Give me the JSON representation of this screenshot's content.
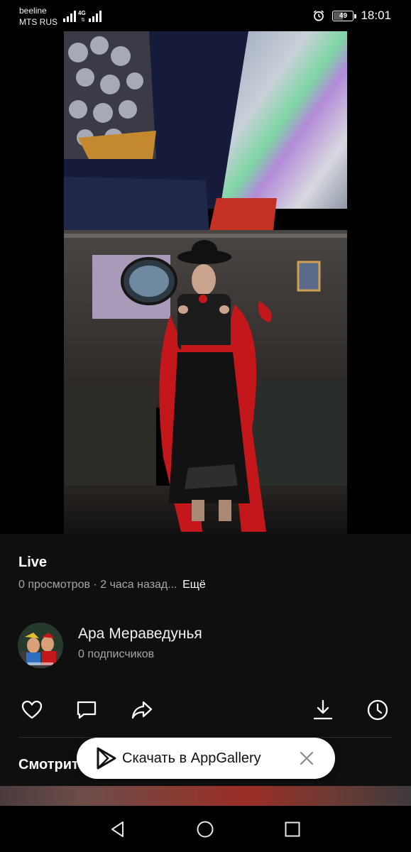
{
  "status_bar": {
    "carrier_1": "beeline",
    "carrier_2": "MTS RUS",
    "network": "4G",
    "battery": "49",
    "time": "18:01"
  },
  "video": {
    "title": "Live",
    "views": "0 просмотров",
    "separator": "·",
    "age": "2 часа назад...",
    "more_label": "Ещё"
  },
  "channel": {
    "name": "Ара Мераведунья",
    "subscribers": "0 подписчиков"
  },
  "actions": [
    "heart-icon",
    "comment-icon",
    "share-icon",
    "download-icon",
    "watch-later-icon"
  ],
  "watch_next": {
    "title": "Смотрите также"
  },
  "banner": {
    "text": "Скачать в AppGallery"
  },
  "nav": [
    "back-icon",
    "home-icon",
    "recents-icon"
  ],
  "colors": {
    "background": "#0f0f0f",
    "secondary_text": "#a6a6a6",
    "banner_background": "#ffffff"
  }
}
